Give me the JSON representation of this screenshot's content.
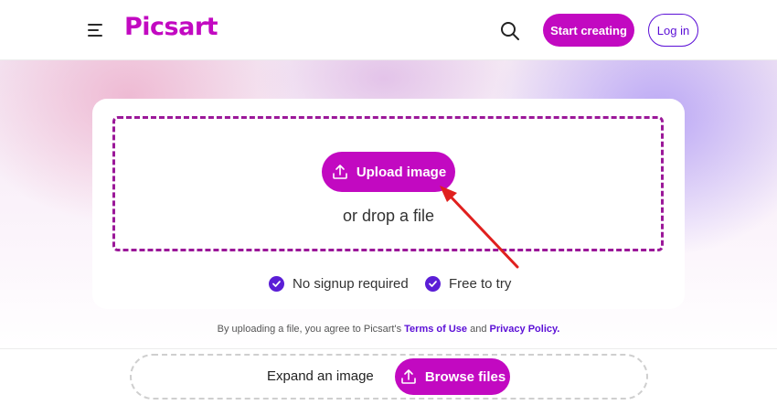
{
  "header": {
    "logo_text": "Picsart",
    "start_label": "Start creating",
    "login_label": "Log in"
  },
  "upload": {
    "button_label": "Upload image",
    "drop_text": "or drop a file"
  },
  "features": [
    {
      "label": "No signup required"
    },
    {
      "label": "Free to try"
    }
  ],
  "terms": {
    "prefix": "By uploading a file, you agree to Picsart's",
    "terms_link": "Terms of Use",
    "connector": "and",
    "privacy_link": "Privacy Policy."
  },
  "bottom": {
    "expand_text": "Expand an image",
    "browse_label": "Browse files"
  },
  "colors": {
    "brand": "#c209c1",
    "accent": "#5b0fd6",
    "annotation": "#e0201e"
  },
  "icons": [
    "menu-icon",
    "search-icon",
    "upload-icon",
    "check-icon"
  ]
}
